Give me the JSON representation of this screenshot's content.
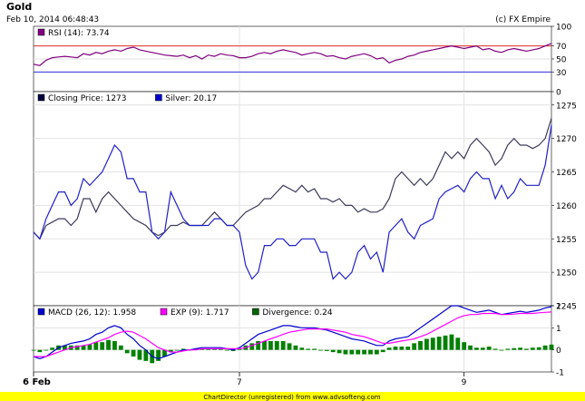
{
  "header": {
    "title": "Gold",
    "timestamp": "Feb 10, 2014 06:48:43",
    "copyright": "(c) FX Empire"
  },
  "footer": {
    "watermark": "ChartDirector (unregistered) from www.advsofteng.com",
    "background": "#ffff00"
  },
  "x_axis": {
    "tick_labels": [
      {
        "label": "6 Feb",
        "index": 0,
        "bold": true
      },
      {
        "label": "7",
        "index": 33,
        "bold": false
      },
      {
        "label": "9",
        "index": 69,
        "bold": false
      }
    ]
  },
  "chart_data": [
    {
      "type": "line",
      "panel": "rsi",
      "legend": [
        {
          "text": "RSI (14): 73.74",
          "color": "#800080"
        }
      ],
      "ylim": [
        0,
        100
      ],
      "yticks": [
        {
          "value": 100,
          "label": "100",
          "color": "#000000"
        },
        {
          "value": 70,
          "label": "70",
          "color": "#e03030"
        },
        {
          "value": 50,
          "label": "50",
          "color": "#000000"
        },
        {
          "value": 30,
          "label": "30",
          "color": "#3030e0"
        },
        {
          "value": 0,
          "label": "0",
          "color": "#000000"
        }
      ],
      "reference_lines": [
        {
          "value": 70,
          "color": "#e03030"
        },
        {
          "value": 30,
          "color": "#3030e0"
        }
      ],
      "series": [
        {
          "color": "#800080",
          "values": [
            42,
            40,
            48,
            52,
            53,
            54,
            53,
            52,
            58,
            56,
            60,
            58,
            62,
            64,
            62,
            66,
            68,
            64,
            62,
            60,
            58,
            56,
            55,
            54,
            56,
            52,
            55,
            50,
            56,
            54,
            58,
            56,
            55,
            52,
            52,
            54,
            58,
            60,
            58,
            62,
            64,
            62,
            60,
            56,
            58,
            60,
            58,
            54,
            55,
            52,
            50,
            54,
            56,
            58,
            55,
            50,
            52,
            44,
            48,
            50,
            54,
            56,
            60,
            62,
            64,
            66,
            68,
            70,
            68,
            66,
            68,
            70,
            64,
            66,
            62,
            60,
            64,
            66,
            64,
            62,
            64,
            66,
            70,
            73.74
          ]
        }
      ]
    },
    {
      "type": "line",
      "panel": "price",
      "legend": [
        {
          "text": "Closing Price: 1273",
          "color": "#000040"
        },
        {
          "text": "Silver: 20.17",
          "color": "#0000cc"
        }
      ],
      "ylim": [
        1245,
        1277
      ],
      "yticks": [
        1245,
        1250,
        1255,
        1260,
        1265,
        1270,
        1275
      ],
      "series": [
        {
          "color": "#3a3a5a",
          "values": [
            1256,
            1255,
            1257,
            1257.5,
            1258,
            1258,
            1257,
            1258,
            1261,
            1261,
            1259,
            1261,
            1262,
            1261,
            1260,
            1259,
            1258,
            1257.5,
            1257,
            1256,
            1255.5,
            1256,
            1257,
            1257,
            1257.5,
            1257,
            1257,
            1257,
            1258,
            1259,
            1258,
            1257,
            1257,
            1258,
            1259,
            1259.5,
            1260,
            1261,
            1261,
            1262,
            1263,
            1262.5,
            1262,
            1263,
            1262,
            1262.5,
            1261,
            1261,
            1260.5,
            1261,
            1260,
            1260,
            1259,
            1259.5,
            1259,
            1259,
            1259.5,
            1261,
            1264,
            1265,
            1264,
            1263,
            1264,
            1263,
            1264,
            1266,
            1268,
            1267,
            1268,
            1267,
            1269,
            1270,
            1269,
            1268,
            1266,
            1267,
            1269,
            1270,
            1269,
            1269,
            1268.5,
            1269,
            1270,
            1273
          ]
        },
        {
          "color": "#2020c8",
          "values": [
            1256,
            1255,
            1258,
            1260,
            1262,
            1262,
            1260,
            1261,
            1264,
            1263,
            1264,
            1265,
            1267,
            1269,
            1268,
            1264,
            1264,
            1262,
            1262,
            1256,
            1255,
            1256,
            1262,
            1260,
            1258,
            1257,
            1257,
            1257,
            1257,
            1258,
            1258,
            1257,
            1257,
            1256,
            1251,
            1249,
            1250,
            1254,
            1254,
            1255,
            1255,
            1254,
            1254,
            1255,
            1255,
            1255,
            1253,
            1253,
            1249,
            1250,
            1249,
            1250,
            1253,
            1254,
            1252,
            1253,
            1250,
            1256,
            1257,
            1258,
            1256,
            1255,
            1257,
            1257.5,
            1258,
            1261,
            1262,
            1262.5,
            1263,
            1262,
            1264,
            1265,
            1264,
            1264,
            1261,
            1263,
            1261,
            1262,
            1264,
            1263,
            1263,
            1263,
            1266,
            1272
          ]
        }
      ]
    },
    {
      "type": "line",
      "panel": "macd",
      "legend": [
        {
          "text": "MACD (26, 12): 1.958",
          "color": "#0000cc"
        },
        {
          "text": "EXP (9): 1.717",
          "color": "#ff00ff"
        },
        {
          "text": "Divergence: 0.24",
          "color": "#006600"
        }
      ],
      "ylim": [
        -1,
        2
      ],
      "yticks": [
        -1,
        0,
        1,
        2
      ],
      "series": [
        {
          "name": "MACD",
          "color": "#0000cc",
          "values": [
            -0.3,
            -0.4,
            -0.3,
            -0.1,
            0.1,
            0.2,
            0.3,
            0.35,
            0.4,
            0.5,
            0.7,
            0.8,
            1.0,
            1.1,
            1.0,
            0.7,
            0.5,
            0.2,
            0.0,
            -0.3,
            -0.4,
            -0.3,
            -0.2,
            -0.1,
            0.0,
            0.0,
            0.05,
            0.1,
            0.1,
            0.1,
            0.1,
            0.05,
            0.0,
            0.1,
            0.3,
            0.5,
            0.7,
            0.8,
            0.9,
            1.0,
            1.1,
            1.1,
            1.05,
            1.0,
            1.0,
            1.0,
            0.95,
            0.9,
            0.8,
            0.7,
            0.6,
            0.5,
            0.45,
            0.4,
            0.3,
            0.2,
            0.2,
            0.4,
            0.5,
            0.55,
            0.6,
            0.8,
            1.0,
            1.2,
            1.4,
            1.6,
            1.8,
            2.0,
            2.0,
            1.9,
            1.8,
            1.7,
            1.75,
            1.8,
            1.7,
            1.6,
            1.65,
            1.7,
            1.75,
            1.7,
            1.75,
            1.8,
            1.9,
            1.958
          ]
        },
        {
          "name": "EXP",
          "color": "#ff00ff",
          "values": [
            -0.3,
            -0.3,
            -0.3,
            -0.2,
            -0.1,
            0.0,
            0.1,
            0.15,
            0.2,
            0.25,
            0.35,
            0.45,
            0.55,
            0.7,
            0.8,
            0.85,
            0.8,
            0.65,
            0.5,
            0.3,
            0.1,
            0.0,
            -0.1,
            -0.1,
            -0.05,
            0.0,
            0.0,
            0.05,
            0.05,
            0.05,
            0.05,
            0.05,
            0.05,
            0.05,
            0.1,
            0.2,
            0.3,
            0.4,
            0.5,
            0.6,
            0.7,
            0.8,
            0.85,
            0.9,
            0.95,
            0.95,
            0.95,
            0.95,
            0.9,
            0.85,
            0.8,
            0.7,
            0.65,
            0.6,
            0.5,
            0.4,
            0.3,
            0.3,
            0.35,
            0.4,
            0.45,
            0.5,
            0.6,
            0.7,
            0.85,
            1.0,
            1.15,
            1.3,
            1.45,
            1.55,
            1.6,
            1.6,
            1.65,
            1.65,
            1.65,
            1.6,
            1.6,
            1.62,
            1.65,
            1.65,
            1.65,
            1.68,
            1.7,
            1.717
          ]
        },
        {
          "name": "Divergence",
          "color": "#008000",
          "kind": "bar",
          "values": [
            0.0,
            -0.1,
            0.0,
            0.1,
            0.2,
            0.2,
            0.2,
            0.2,
            0.2,
            0.25,
            0.35,
            0.35,
            0.45,
            0.4,
            0.2,
            -0.15,
            -0.3,
            -0.45,
            -0.5,
            -0.6,
            -0.5,
            -0.3,
            -0.1,
            0.0,
            0.05,
            0.0,
            0.05,
            0.05,
            0.05,
            0.05,
            0.05,
            0.0,
            -0.05,
            0.05,
            0.2,
            0.3,
            0.4,
            0.4,
            0.4,
            0.4,
            0.4,
            0.3,
            0.2,
            0.1,
            0.05,
            0.05,
            0.0,
            -0.05,
            -0.1,
            -0.15,
            -0.2,
            -0.2,
            -0.2,
            -0.2,
            -0.2,
            -0.2,
            -0.1,
            0.1,
            0.15,
            0.15,
            0.15,
            0.3,
            0.4,
            0.5,
            0.55,
            0.6,
            0.65,
            0.7,
            0.55,
            0.35,
            0.2,
            0.1,
            0.1,
            0.15,
            0.05,
            0.0,
            0.05,
            0.08,
            0.1,
            0.05,
            0.1,
            0.12,
            0.2,
            0.24
          ]
        }
      ]
    }
  ]
}
